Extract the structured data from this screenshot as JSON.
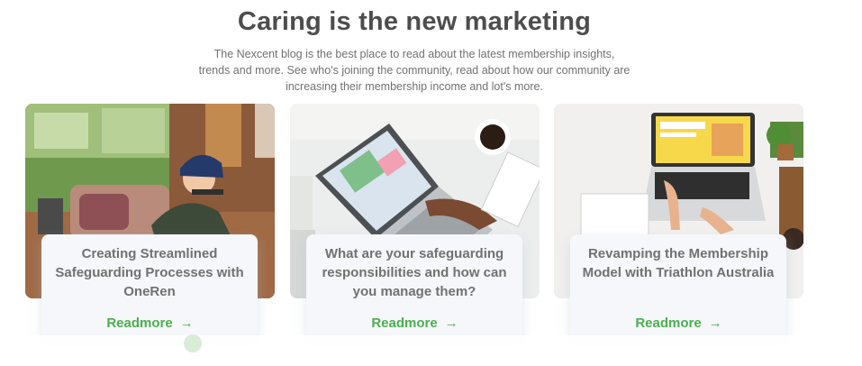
{
  "section": {
    "title": "Caring is the new marketing",
    "description": "The Nexcent blog is the best place to read about the latest membership insights, trends and more. See who's joining the community, read about how our community are increasing their membership income and lot's more."
  },
  "cards": [
    {
      "title": "Creating Streamlined Safeguarding Processes with OneRen",
      "readmore": "Readmore",
      "arrow": "→",
      "image": "woman-with-laptop-on-couch-photo"
    },
    {
      "title": "What are your safeguarding responsibilities and how can you manage them?",
      "readmore": "Readmore",
      "arrow": "→",
      "image": "laptop-with-charts-and-coffee-photo"
    },
    {
      "title": "Revamping the Membership Model with Triathlon Australia",
      "readmore": "Readmore",
      "arrow": "→",
      "image": "hands-typing-on-laptop-photo"
    }
  ],
  "colors": {
    "heading": "#4d4d4d",
    "body": "#717171",
    "accent": "#4caf4f",
    "card_bg": "#f5f7fa"
  }
}
